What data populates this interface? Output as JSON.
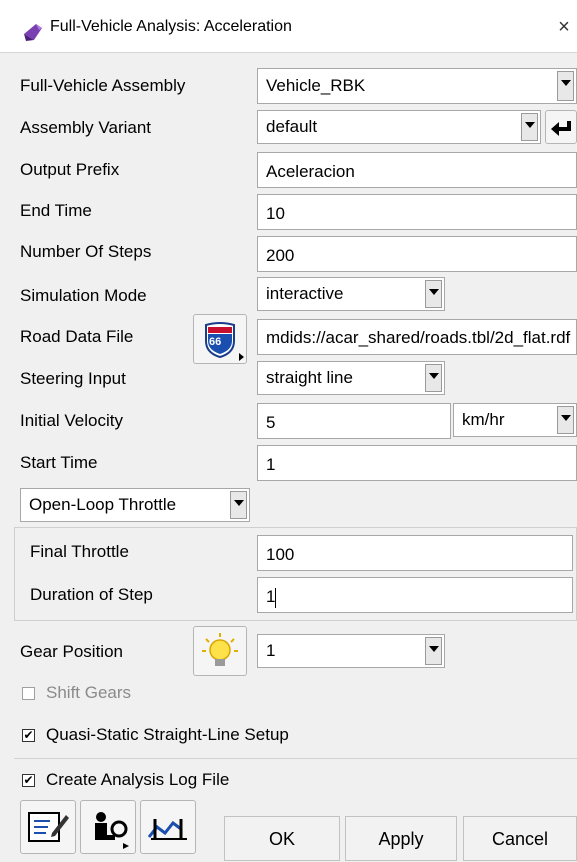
{
  "window": {
    "title": "Full-Vehicle Analysis: Acceleration",
    "close": "×"
  },
  "rows": {
    "assembly": {
      "label": "Full-Vehicle Assembly",
      "value": "Vehicle_RBK"
    },
    "variant": {
      "label": "Assembly Variant",
      "value": "default"
    },
    "prefix": {
      "label": "Output Prefix",
      "value": "Aceleracion"
    },
    "end_time": {
      "label": "End Time",
      "value": "10"
    },
    "steps": {
      "label": "Number Of Steps",
      "value": "200"
    },
    "sim_mode": {
      "label": "Simulation Mode",
      "value": "interactive"
    },
    "road": {
      "label": "Road Data File",
      "value": "mdids://acar_shared/roads.tbl/2d_flat.rdf",
      "icon_text": "66"
    },
    "steering": {
      "label": "Steering Input",
      "value": "straight line"
    },
    "velocity": {
      "label": "Initial Velocity",
      "value": "5",
      "unit": "km/hr"
    },
    "start_time": {
      "label": "Start Time",
      "value": "1"
    }
  },
  "throttle": {
    "mode": "Open-Loop Throttle",
    "final_label": "Final Throttle",
    "final_value": "100",
    "duration_label": "Duration of Step",
    "duration_value": "1"
  },
  "gear": {
    "label": "Gear Position",
    "value": "1"
  },
  "checks": {
    "shift_gears": {
      "label": "Shift Gears",
      "checked": false
    },
    "quasi_static": {
      "label": "Quasi-Static Straight-Line Setup",
      "checked": true,
      "mark": "✔"
    },
    "log_file": {
      "label": "Create Analysis Log File",
      "checked": true,
      "mark": "✔"
    }
  },
  "buttons": {
    "ok": "OK",
    "apply": "Apply",
    "cancel": "Cancel"
  },
  "colors": {
    "background": "#f0f0f0",
    "field": "#ffffff",
    "disabled_text": "#8a8a8a"
  }
}
